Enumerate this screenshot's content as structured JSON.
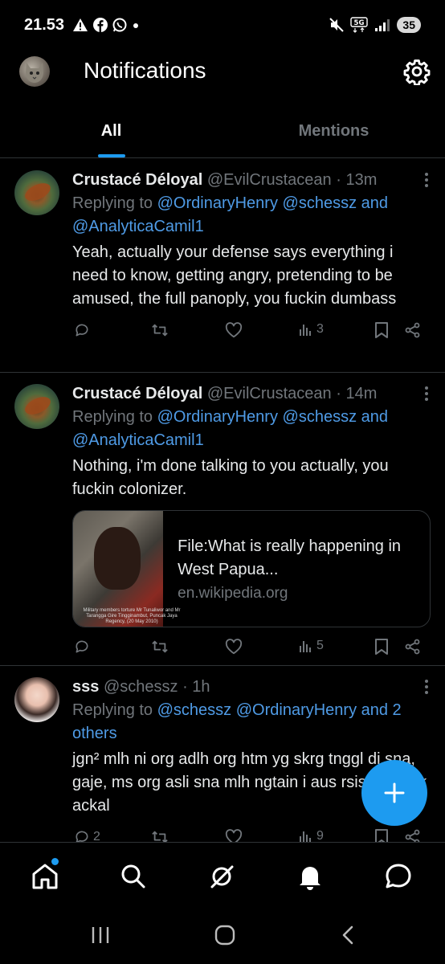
{
  "status_bar": {
    "time": "21.53",
    "network": "5G",
    "battery": "35"
  },
  "header": {
    "title": "Notifications"
  },
  "tabs": [
    {
      "label": "All",
      "active": true
    },
    {
      "label": "Mentions",
      "active": false
    }
  ],
  "posts": [
    {
      "name": "Crustacé Déloyal",
      "handle": "@EvilCrustacean",
      "time": "· 13m",
      "replying_prefix": "Replying to ",
      "mentions_line1": "@OrdinaryHenry @schessz",
      "and_text": " and",
      "mentions_line2": "@AnalyticaCamil1",
      "body": "Yeah, actually your defense says everything i need to know, getting angry, pretending to be amused, the full panoply, you fuckin dumbass",
      "views": "3"
    },
    {
      "name": "Crustacé Déloyal",
      "handle": "@EvilCrustacean",
      "time": "· 14m",
      "replying_prefix": "Replying to ",
      "mentions_line1": "@OrdinaryHenry @schessz",
      "and_text": " and",
      "mentions_line2": "@AnalyticaCamil1",
      "body": "Nothing, i'm done talking to you actually, you fuckin colonizer.",
      "card": {
        "title": "File:What is really happening in West Papua...",
        "domain": "en.wikipedia.org",
        "thumb_caption": "Military members torture Mr Tunaliwor and Mr Tarangga Gire Tingginambut, Puncak Jaya Regency, (20 May 2010)"
      },
      "views": "5"
    },
    {
      "name": "sss",
      "handle": "@schessz",
      "time": "· 1h",
      "replying_prefix": "Replying to ",
      "mentions_line1": "@schessz @OrdinaryHenry",
      "and_text": " and 2",
      "mentions_line2": "others",
      "body": "jgn² mlh ni org adlh org htm yg skrg tnggl di sna, gaje, ms org asli sna mlh ngtain i aus rsis, ga msk ackal",
      "replies": "2",
      "views": "9"
    }
  ],
  "colors": {
    "accent": "#1d9bf0",
    "mention": "#4f9be6",
    "muted": "#71767b",
    "background": "#000000"
  },
  "icons": {
    "fab": "plus-icon",
    "nav": [
      "home-icon",
      "search-icon",
      "grok-icon",
      "notifications-bell-icon",
      "messages-icon"
    ]
  }
}
